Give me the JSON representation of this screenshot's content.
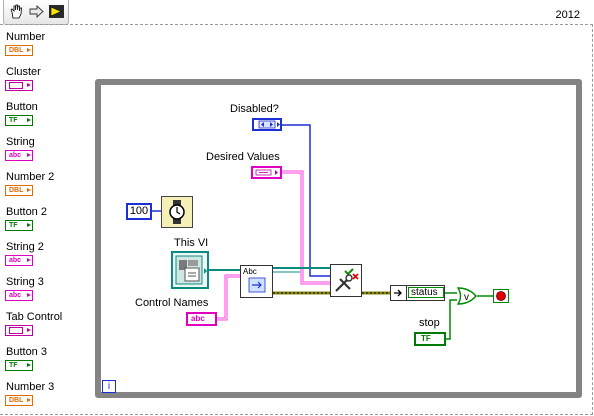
{
  "window": {
    "year": "2012"
  },
  "toolbar": {
    "icons": [
      "hand-scroll-icon",
      "arrow-right-icon",
      "run-arrow-icon"
    ]
  },
  "terminals": [
    {
      "label": "Number",
      "type": "DBL"
    },
    {
      "label": "Cluster",
      "type": "cluster"
    },
    {
      "label": "Button",
      "type": "TF"
    },
    {
      "label": "String",
      "type": "abc"
    },
    {
      "label": "Number 2",
      "type": "DBL"
    },
    {
      "label": "Button 2",
      "type": "TF"
    },
    {
      "label": "String 2",
      "type": "abc"
    },
    {
      "label": "String 3",
      "type": "abc"
    },
    {
      "label": "Tab Control",
      "type": "cluster"
    },
    {
      "label": "Button 3",
      "type": "TF"
    },
    {
      "label": "Number 3",
      "type": "DBL"
    }
  ],
  "loop": {
    "disabled_label": "Disabled?",
    "desired_values_label": "Desired Values",
    "wait_constant": "100",
    "this_vi_label": "This VI",
    "control_names_label": "Control Names",
    "control_names_type": "abc",
    "status_label": "status",
    "stop_label": "stop",
    "stop_type": "TF",
    "iteration_terminal": "i",
    "string_node_label": "Abc"
  },
  "colors": {
    "loop_border": "#848484",
    "wire_blue": "#1f2fd6",
    "wire_pink": "#ff3fe0",
    "wire_teal": "#0a8c80",
    "wire_green": "#008a00",
    "wire_yellow": "#c8c800"
  }
}
